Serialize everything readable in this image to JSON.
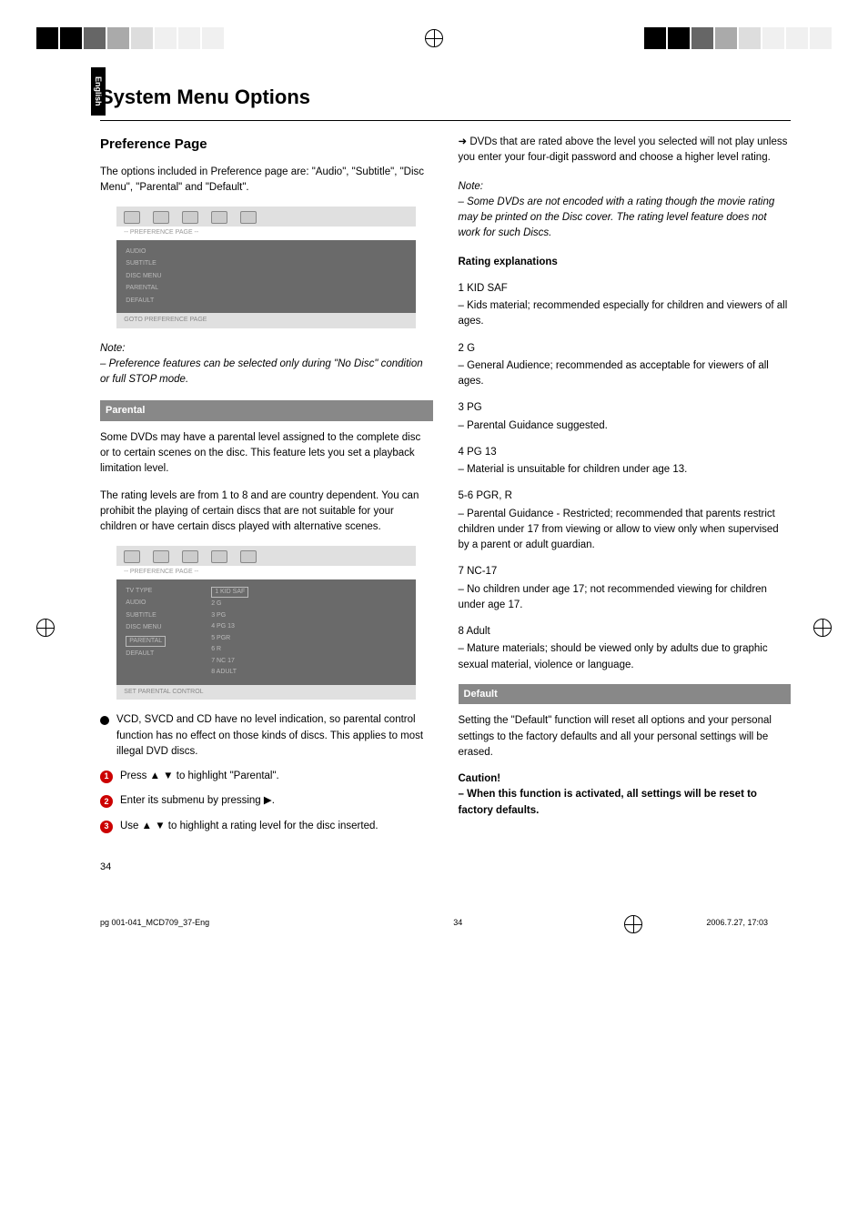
{
  "sideTab": "English",
  "pageTitle": "System Menu Options",
  "leftCol": {
    "sectionHeading": "Preference Page",
    "intro": "The options included in Preference page are: \"Audio\", \"Subtitle\", \"Disc Menu\", \"Parental\" and \"Default\".",
    "screenshot1": {
      "banner": "-- PREFERENCE PAGE --",
      "items": [
        "AUDIO",
        "SUBTITLE",
        "DISC MENU",
        "PARENTAL",
        "DEFAULT"
      ],
      "footer": "GOTO PREFERENCE PAGE"
    },
    "note1Label": "Note:",
    "note1": "– Preference features can be selected only during \"No Disc\" condition or full STOP mode.",
    "parentalHeading": "Parental",
    "parental1": "Some DVDs may have a parental level assigned to the complete disc or to certain scenes on the disc. This feature lets you set a playback limitation level.",
    "parental2": "The rating levels are from 1 to 8 and are country dependent. You can prohibit the playing of certain discs that are not suitable for your children or have certain discs played with alternative scenes.",
    "screenshot2": {
      "banner": "-- PREFERENCE PAGE --",
      "items": [
        "TV TYPE",
        "AUDIO",
        "SUBTITLE",
        "DISC MENU",
        "PARENTAL",
        "DEFAULT"
      ],
      "sublist": [
        "1 KID SAF",
        "2 G",
        "3 PG",
        "4 PG 13",
        "5 PGR",
        "6 R",
        "7 NC 17",
        "8 ADULT"
      ],
      "footer": "SET PARENTAL CONTROL"
    },
    "bulletStep": "VCD, SVCD and CD have no level indication, so parental control function has no effect on those kinds of discs. This applies to most illegal DVD discs.",
    "step1": "Press ▲ ▼ to highlight \"Parental\".",
    "step2": "Enter its submenu by pressing ▶.",
    "step3": "Use ▲ ▼ to highlight a rating level for the disc inserted."
  },
  "rightCol": {
    "arrowText": "➜ DVDs that are rated above the level you selected will not play unless you enter your four-digit password and choose a higher level rating.",
    "note2Label": "Note:",
    "note2": "– Some DVDs are not encoded with a rating though the movie rating may be printed on the Disc cover. The rating level feature does not work for such Discs.",
    "ratingExplHeading": "Rating explanations",
    "ratings": [
      {
        "name": "1 KID SAF",
        "desc": "– Kids material; recommended especially for children and viewers of all ages."
      },
      {
        "name": "2 G",
        "desc": "– General Audience; recommended as acceptable for viewers of all ages."
      },
      {
        "name": "3 PG",
        "desc": "– Parental Guidance suggested."
      },
      {
        "name": "4 PG 13",
        "desc": "– Material is unsuitable for children under age 13."
      },
      {
        "name": "5-6 PGR, R",
        "desc": "– Parental Guidance - Restricted; recommended that parents restrict children under 17 from viewing or allow to view only when supervised by a parent or adult guardian."
      },
      {
        "name": "7 NC-17",
        "desc": "– No children under age 17; not recommended viewing for children under age 17."
      },
      {
        "name": "8 Adult",
        "desc": "– Mature materials; should be viewed only by adults due to graphic sexual material, violence or language."
      }
    ],
    "defaultHeading": "Default",
    "defaultText": "Setting the \"Default\" function will reset all options and your personal settings to the factory defaults and all your personal settings will be erased.",
    "cautionLabel": "Caution!",
    "cautionText": "– When this function is activated, all settings will be reset to factory defaults."
  },
  "pageNumber": "34",
  "footer": {
    "left": "pg 001-041_MCD709_37-Eng",
    "center": "34",
    "right": "2006.7.27, 17:03"
  }
}
